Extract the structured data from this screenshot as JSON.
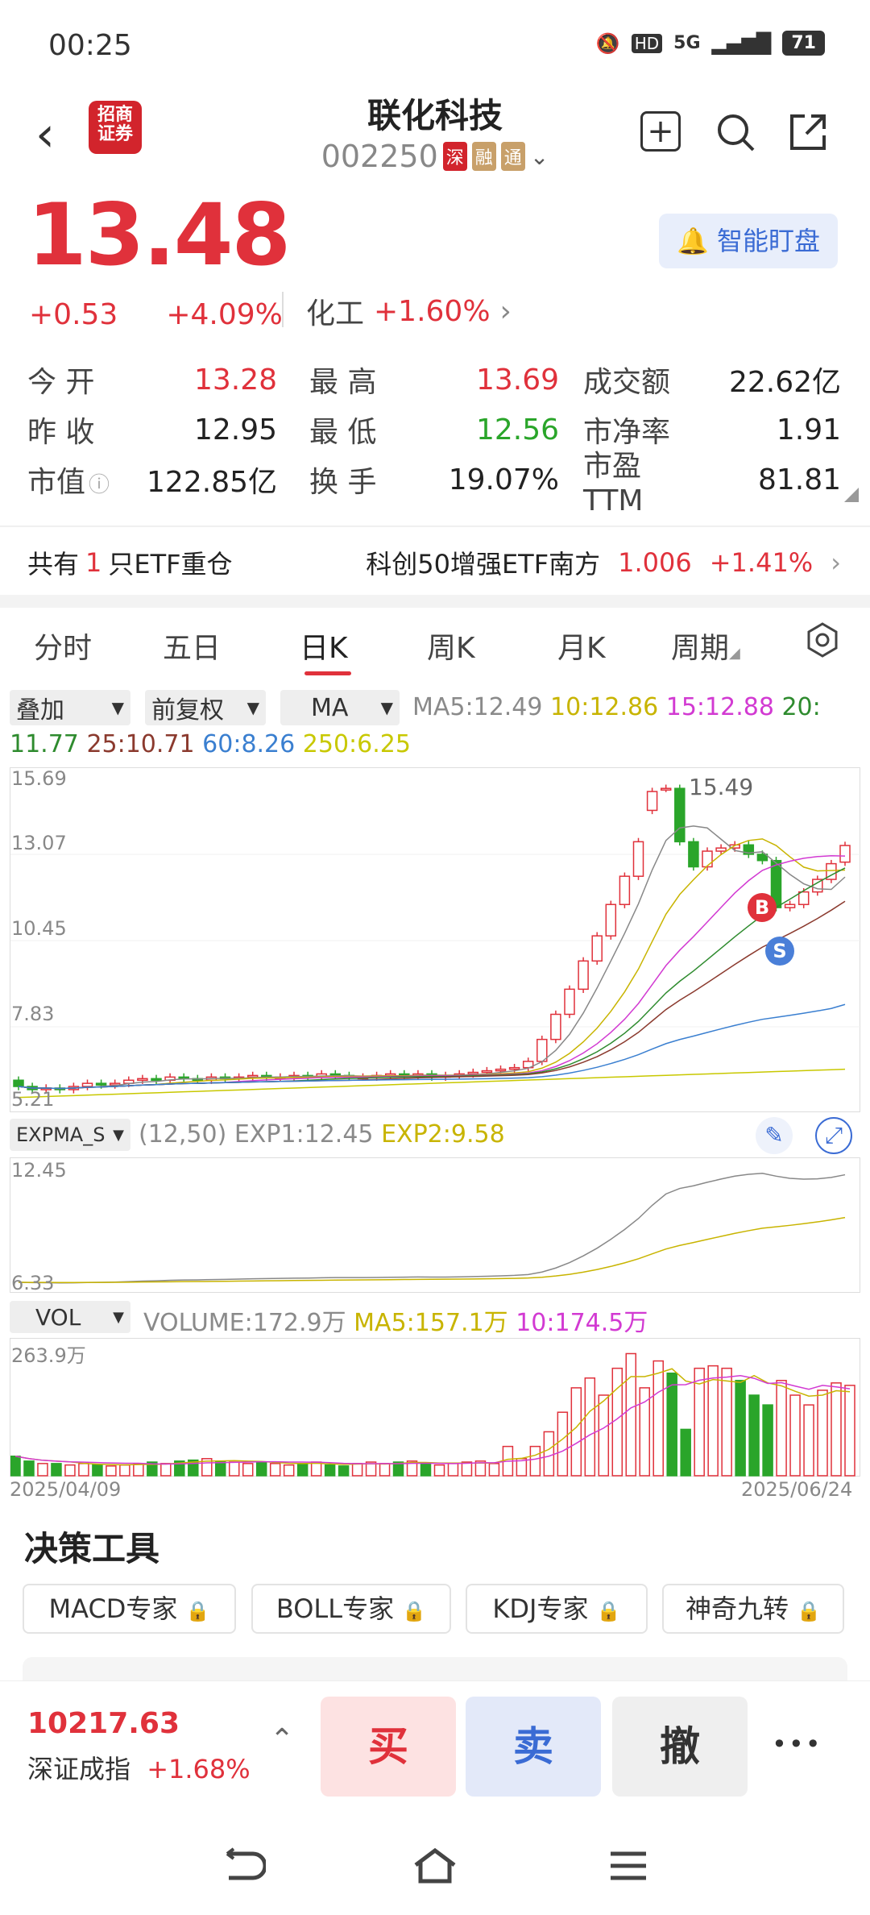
{
  "status": {
    "time": "00:25",
    "network": "5G",
    "battery": "71"
  },
  "header": {
    "stock_name": "联化科技",
    "stock_code": "002250",
    "tags": [
      "深",
      "融",
      "通"
    ],
    "logo_line1": "招商",
    "logo_line2": "证券"
  },
  "price": {
    "current": "13.48",
    "change": "+0.53",
    "change_pct": "+4.09%"
  },
  "sector": {
    "name": "化工",
    "change": "+1.60%"
  },
  "watch_button": "智能盯盘",
  "quote": {
    "open_label": "今 开",
    "open": "13.28",
    "high_label": "最 高",
    "high": "13.69",
    "turnover_amt_label": "成交额",
    "turnover_amt": "22.62亿",
    "prev_close_label": "昨 收",
    "prev_close": "12.95",
    "low_label": "最 低",
    "low": "12.56",
    "pb_label": "市净率",
    "pb": "1.91",
    "mktcap_label": "市值",
    "mktcap": "122.85亿",
    "turnover_rate_label": "换 手",
    "turnover_rate": "19.07%",
    "pe_label": "市盈TTM",
    "pe": "81.81"
  },
  "etf": {
    "prefix": "共有",
    "count": "1",
    "suffix": "只ETF重仓",
    "name": "科创50增强ETF南方",
    "price": "1.006",
    "change": "+1.41%"
  },
  "tabs": [
    "分时",
    "五日",
    "日K",
    "周K",
    "月K",
    "周期"
  ],
  "active_tab": "日K",
  "chart_controls": {
    "overlay": "叠加",
    "adjust": "前复权",
    "indicator": "MA"
  },
  "ma_legend": {
    "ma5": "MA5:12.49",
    "ma10": "10:12.86",
    "ma15": "15:12.88",
    "ma20": "20:",
    "ma20v": "11.77",
    "ma25": "25:10.71",
    "ma60": "60:8.26",
    "ma250": "250:6.25"
  },
  "colors": {
    "up": "#e0313b",
    "down": "#2aa52a",
    "ma5": "#888888",
    "ma10": "#c8b400",
    "ma15": "#d23ad2",
    "ma20": "#2e8b2e",
    "ma25": "#8b3a2e",
    "ma60": "#3a7fd0",
    "ma250": "#c8c800"
  },
  "chart_data": [
    {
      "type": "candlestick",
      "y_ticks": [
        "15.69",
        "13.07",
        "10.45",
        "7.83",
        "5.21"
      ],
      "ylim": [
        5.21,
        15.69
      ],
      "x_start": "2025/04/09",
      "x_end": "2025/06/24",
      "max_label": "15.49",
      "markers": [
        "B",
        "S"
      ],
      "closes": [
        5.8,
        5.7,
        5.75,
        5.7,
        5.8,
        5.9,
        5.85,
        5.9,
        6.0,
        6.05,
        6.0,
        6.1,
        6.05,
        6.0,
        6.1,
        6.05,
        6.1,
        6.15,
        6.1,
        6.1,
        6.15,
        6.1,
        6.2,
        6.15,
        6.1,
        6.1,
        6.15,
        6.2,
        6.15,
        6.2,
        6.1,
        6.15,
        6.2,
        6.25,
        6.3,
        6.35,
        6.4,
        6.6,
        7.3,
        8.1,
        8.9,
        9.8,
        10.6,
        11.6,
        12.5,
        13.6,
        15.2,
        15.3,
        13.6,
        12.8,
        13.3,
        13.4,
        13.5,
        13.2,
        13.0,
        11.5,
        11.6,
        12.0,
        12.4,
        12.9,
        13.48
      ],
      "opens": [
        6.0,
        5.8,
        5.7,
        5.75,
        5.7,
        5.8,
        5.9,
        5.85,
        5.9,
        6.0,
        6.05,
        6.0,
        6.1,
        6.05,
        6.0,
        6.1,
        6.05,
        6.1,
        6.15,
        6.1,
        6.1,
        6.15,
        6.1,
        6.2,
        6.15,
        6.1,
        6.1,
        6.15,
        6.2,
        6.15,
        6.2,
        6.1,
        6.15,
        6.2,
        6.25,
        6.3,
        6.35,
        6.4,
        6.6,
        7.3,
        8.1,
        8.9,
        9.8,
        10.6,
        11.6,
        12.5,
        14.6,
        15.3,
        15.3,
        13.6,
        12.8,
        13.3,
        13.4,
        13.5,
        13.2,
        13.0,
        11.5,
        11.6,
        12.0,
        12.4,
        12.95
      ]
    },
    {
      "type": "line",
      "name": "EXPMA_S",
      "params": "(12,50)",
      "exp1": "EXP1:12.45",
      "exp2": "EXP2:9.58",
      "y_ticks": [
        "12.45",
        "6.33"
      ]
    },
    {
      "type": "bar",
      "name": "VOL",
      "volume": "VOLUME:172.9万",
      "ma5": "MA5:157.1万",
      "ma10": "10:174.5万",
      "y_top": "263.9万",
      "values": [
        40,
        30,
        25,
        25,
        22,
        25,
        22,
        20,
        22,
        25,
        28,
        25,
        30,
        32,
        35,
        30,
        28,
        25,
        28,
        25,
        22,
        25,
        28,
        22,
        20,
        25,
        28,
        25,
        28,
        30,
        25,
        22,
        25,
        28,
        30,
        25,
        60,
        35,
        60,
        90,
        130,
        180,
        200,
        165,
        220,
        250,
        180,
        235,
        210,
        95,
        220,
        225,
        220,
        195,
        165,
        145,
        195,
        165,
        145,
        175,
        190,
        185
      ]
    }
  ],
  "tools": {
    "title": "决策工具",
    "items": [
      "MACD专家",
      "BOLL专家",
      "KDJ专家",
      "神奇九转"
    ]
  },
  "index": {
    "value": "10217.63",
    "name": "深证成指",
    "change": "+1.68%"
  },
  "trade": {
    "buy": "买",
    "sell": "卖",
    "cancel": "撤",
    "more": "•••"
  }
}
